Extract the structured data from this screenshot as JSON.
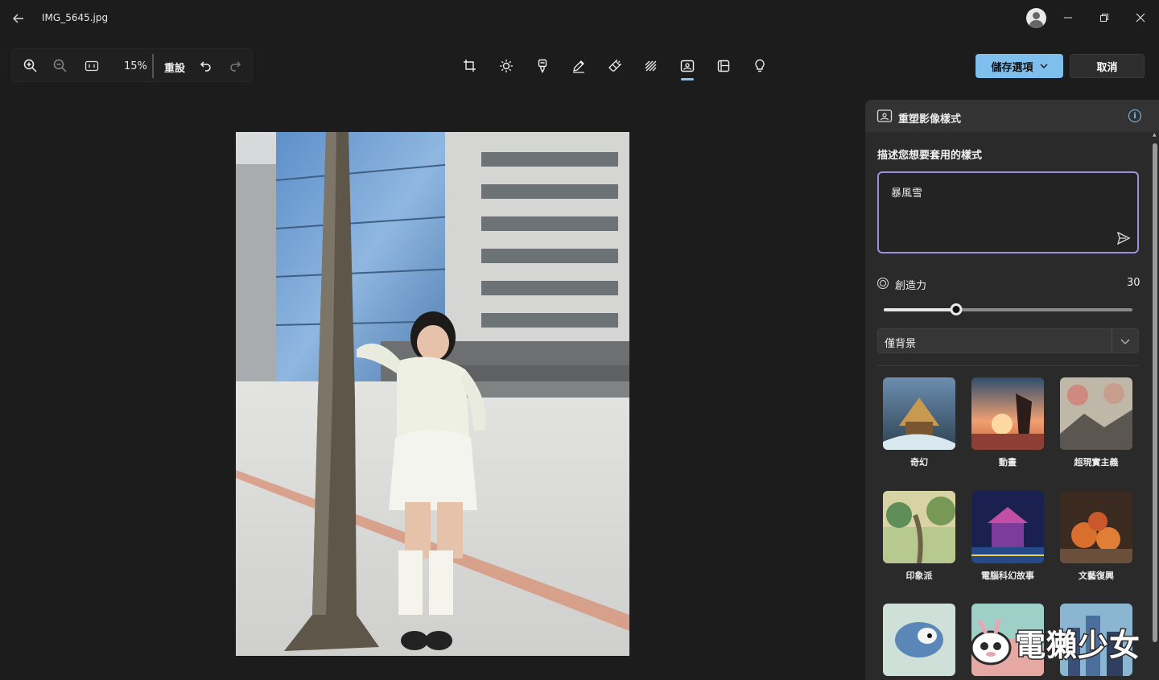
{
  "titlebar": {
    "filename": "IMG_5645.jpg"
  },
  "toolbar": {
    "zoom_value": "15%",
    "reset_label": "重設",
    "save_options_label": "儲存選項",
    "cancel_label": "取消"
  },
  "panel": {
    "title": "重塑影像樣式",
    "describe_label": "描述您想要套用的樣式",
    "prompt_value": "暴風雪",
    "creativity_label": "創造力",
    "creativity_value": "30",
    "creativity_fraction": 0.29,
    "scope_selected": "僅背景",
    "styles": [
      {
        "label": "奇幻"
      },
      {
        "label": "動畫"
      },
      {
        "label": "超現實主義"
      },
      {
        "label": "印象派"
      },
      {
        "label": "電腦科幻故事"
      },
      {
        "label": "文藝復興"
      },
      {
        "label": ""
      },
      {
        "label": ""
      },
      {
        "label": ""
      }
    ]
  },
  "watermark": {
    "text": "電獺少女"
  },
  "colors": {
    "accent": "#7fbfee",
    "prompt_border": "#9c8fdc",
    "background": "#1c1c1c",
    "panel": "#2a2a2a"
  },
  "icons": [
    "back-arrow-icon",
    "avatar-icon",
    "minimize-icon",
    "restore-icon",
    "close-icon",
    "zoom-in-icon",
    "zoom-out-icon",
    "actual-size-icon",
    "undo-icon",
    "redo-icon",
    "crop-icon",
    "adjust-icon",
    "filter-icon",
    "markup-icon",
    "erase-icon",
    "blur-background-icon",
    "restyle-icon",
    "frame-icon",
    "lightbulb-icon",
    "info-icon",
    "send-icon",
    "creativity-icon",
    "chevron-down-icon"
  ]
}
